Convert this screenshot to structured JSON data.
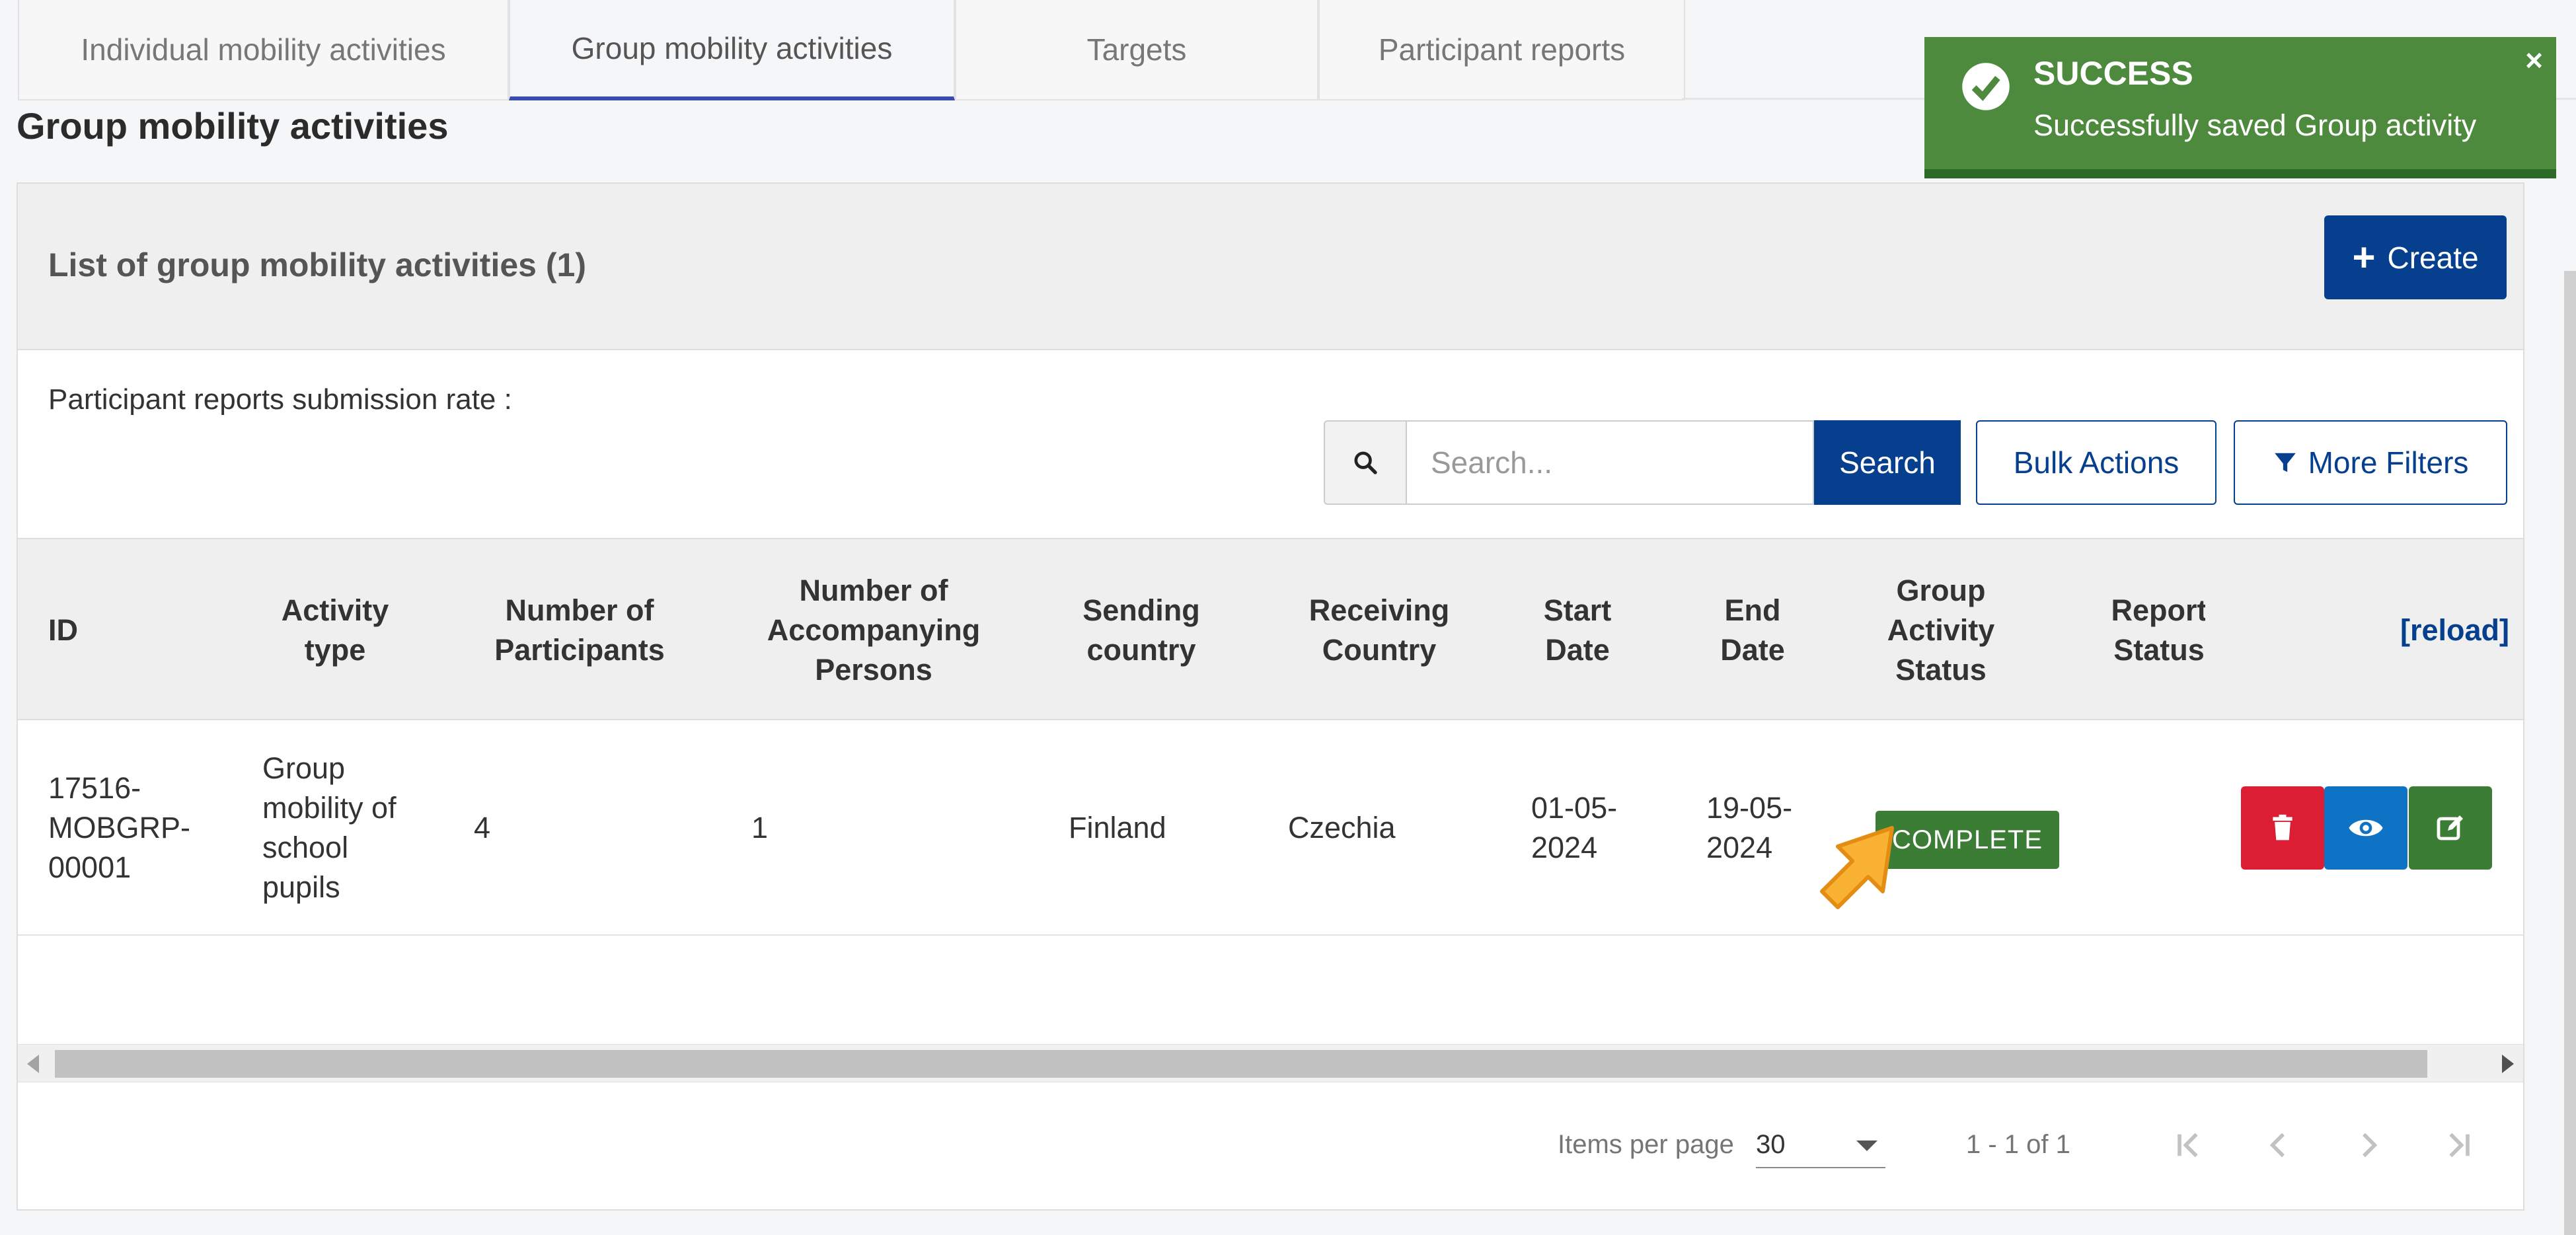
{
  "tabs": [
    {
      "label": "Individual mobility activities",
      "active": false
    },
    {
      "label": "Group mobility activities",
      "active": true
    },
    {
      "label": "Targets",
      "active": false
    },
    {
      "label": "Participant reports",
      "active": false
    }
  ],
  "page_title": "Group mobility activities",
  "panel": {
    "title": "List of group mobility activities (1)",
    "create_label": "Create",
    "rate_label": "Participant reports submission rate :"
  },
  "search": {
    "placeholder": "Search...",
    "button_label": "Search"
  },
  "bulk_actions_label": "Bulk Actions",
  "more_filters_label": "More Filters",
  "table": {
    "headers": {
      "id": "ID",
      "activity_type": "Activity type",
      "participants": "Number of Participants",
      "accompanying": "Number of Accompanying Persons",
      "sending": "Sending country",
      "receiving": "Receiving Country",
      "start": "Start Date",
      "end": "End Date",
      "group_status": "Group Activity Status",
      "report_status": "Report Status",
      "reload": "[reload]"
    },
    "rows": [
      {
        "id": "17516-MOBGRP-00001",
        "activity_type": "Group mobility of school pupils",
        "participants": "4",
        "accompanying": "1",
        "sending": "Finland",
        "receiving": "Czechia",
        "start": "01-05-2024",
        "end": "19-05-2024",
        "group_status": "COMPLETE",
        "report_status": ""
      }
    ]
  },
  "paginator": {
    "items_per_page_label": "Items per page",
    "items_per_page": "30",
    "range": "1 - 1 of 1"
  },
  "toast": {
    "title": "SUCCESS",
    "message": "Successfully saved Group activity",
    "close": "×"
  },
  "colors": {
    "primary": "#063f8d",
    "success": "#3c7d35",
    "danger": "#dc1e35",
    "info": "#0f73c5",
    "tab_active": "#3a4dad"
  },
  "icons": [
    "plus-icon",
    "search-icon",
    "filter-icon",
    "trash-icon",
    "eye-icon",
    "edit-icon",
    "check-circle-icon",
    "close-icon",
    "first-page-icon",
    "prev-page-icon",
    "next-page-icon",
    "last-page-icon"
  ]
}
